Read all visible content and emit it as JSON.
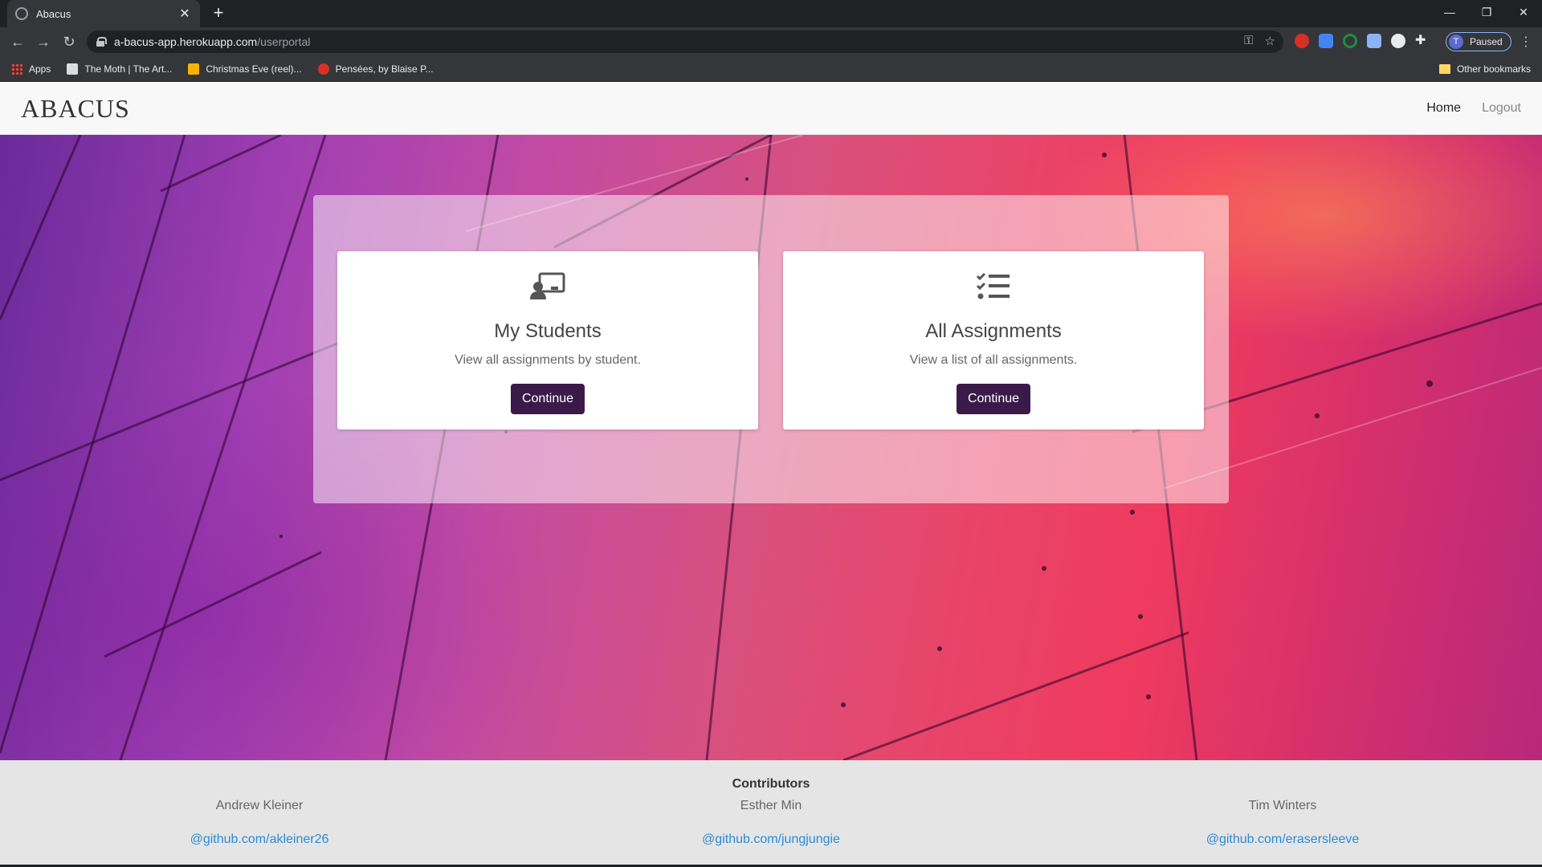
{
  "browser": {
    "tab_title": "Abacus",
    "url_host": "a-bacus-app.herokuapp.com",
    "url_path": "/userportal",
    "profile_initial": "T",
    "profile_status": "Paused",
    "bookmarks": [
      {
        "label": "Apps",
        "icon": "apps-grid-icon",
        "color": "#ea4335"
      },
      {
        "label": "The Moth | The Art...",
        "icon": "moth-icon",
        "color": "#dadce0"
      },
      {
        "label": "Christmas Eve (reel)...",
        "icon": "s-icon",
        "color": "#f4b400"
      },
      {
        "label": "Pensées, by Blaise P...",
        "icon": "pensees-icon",
        "color": "#d93025"
      }
    ],
    "other_bookmarks": "Other bookmarks"
  },
  "app": {
    "brand": "ABACUS",
    "nav_home": "Home",
    "nav_logout": "Logout"
  },
  "cards": {
    "students": {
      "icon": "teacher-board-icon",
      "title": "My Students",
      "text": "View all assignments by student.",
      "button": "Continue"
    },
    "assignments": {
      "icon": "checklist-icon",
      "title": "All Assignments",
      "text": "View a list of all assignments.",
      "button": "Continue"
    }
  },
  "footer": {
    "heading": "Contributors",
    "contributors": [
      {
        "name": "Andrew Kleiner",
        "link": "@github.com/akleiner26"
      },
      {
        "name": "Esther Min",
        "link": "@github.com/jungjungie"
      },
      {
        "name": "Tim Winters",
        "link": "@github.com/erasersleeve"
      }
    ]
  },
  "colors": {
    "button_bg": "#3b1a4a",
    "link": "#2a8bd8",
    "navbar_bg": "#f8f8f8",
    "footer_bg": "#e5e5e5"
  }
}
